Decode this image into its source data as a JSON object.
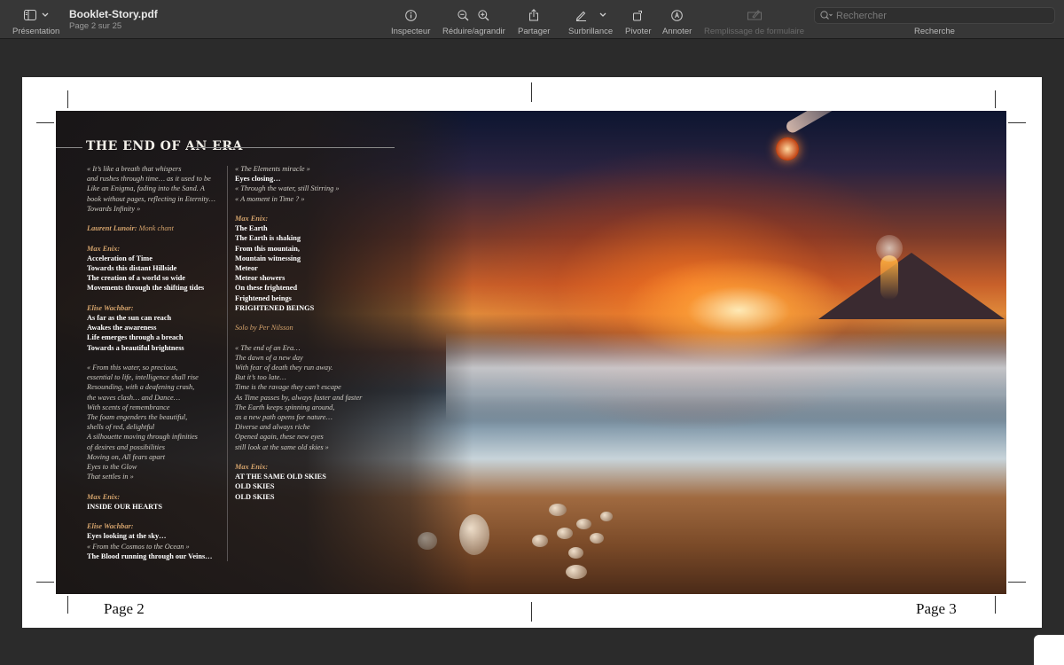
{
  "toolbar": {
    "presentation_label": "Présentation",
    "doc_name": "Booklet-Story.pdf",
    "doc_page": "Page 2 sur 25",
    "inspector_label": "Inspecteur",
    "zoom_label": "Réduire/agrandir",
    "share_label": "Partager",
    "highlight_label": "Surbrillance",
    "rotate_label": "Pivoter",
    "annotate_label": "Annoter",
    "form_label": "Remplissage de formulaire",
    "search_placeholder": "Rechercher",
    "search_label": "Recherche"
  },
  "spread": {
    "title": "THE END OF AN ERA",
    "left_column": [
      {
        "lines": [
          {
            "t": "« It’s like a breath that whispers",
            "s": "it"
          },
          {
            "t": "and rushes through time… as it used to be",
            "s": "it"
          },
          {
            "t": "Like an Enigma, fading into the Sand. A",
            "s": "it"
          },
          {
            "t": "book without pages, reflecting in Eternity…",
            "s": "it"
          },
          {
            "t": "Towards Infinity »",
            "s": "it"
          }
        ]
      },
      {
        "lines": [
          {
            "t": "Laurent Lunoir: ",
            "s": "spk",
            "t2": "Monk chant",
            "s2": "spk-inline"
          }
        ]
      },
      {
        "lines": [
          {
            "t": "Max Enix:",
            "s": "spk"
          },
          {
            "t": "Acceleration of Time",
            "s": "b"
          },
          {
            "t": "Towards this distant Hillside",
            "s": "b"
          },
          {
            "t": "The creation of a world so wide",
            "s": "b"
          },
          {
            "t": "Movements through the shifting tides",
            "s": "b"
          }
        ]
      },
      {
        "lines": [
          {
            "t": "Elise Wachbar:",
            "s": "spk"
          },
          {
            "t": "As far as the sun can reach",
            "s": "b"
          },
          {
            "t": "Awakes the awareness",
            "s": "b"
          },
          {
            "t": "Life emerges through a breach",
            "s": "b"
          },
          {
            "t": "Towards a beautiful brightness",
            "s": "b"
          }
        ]
      },
      {
        "lines": [
          {
            "t": "« From this water, so precious,",
            "s": "it"
          },
          {
            "t": "essential to life, intelligence shall rise",
            "s": "it"
          },
          {
            "t": "Resounding, with a deafening crash,",
            "s": "it"
          },
          {
            "t": "the waves clash… and Dance…",
            "s": "it"
          },
          {
            "t": "With scents of remembrance",
            "s": "it"
          },
          {
            "t": "The foam engenders the beautiful,",
            "s": "it"
          },
          {
            "t": "shells of red, delightful",
            "s": "it"
          },
          {
            "t": "A silhouette moving through infinities",
            "s": "it"
          },
          {
            "t": "of desires and possibilities",
            "s": "it"
          },
          {
            "t": "Moving on, All fears apart",
            "s": "it"
          },
          {
            "t": "Eyes to the Glow",
            "s": "it"
          },
          {
            "t": "That settles in »",
            "s": "it"
          }
        ]
      },
      {
        "lines": [
          {
            "t": "Max Enix:",
            "s": "spk"
          },
          {
            "t": "INSIDE OUR HEARTS",
            "s": "b"
          }
        ]
      },
      {
        "lines": [
          {
            "t": "Elise Wachbar:",
            "s": "spk"
          },
          {
            "t": "Eyes looking at the sky…",
            "s": "b"
          },
          {
            "t": "« From the Cosmos to the Ocean »",
            "s": "it"
          },
          {
            "t": "The Blood running through our Veins…",
            "s": "b"
          }
        ]
      }
    ],
    "right_column": [
      {
        "lines": [
          {
            "t": "« The Elements miracle »",
            "s": "it"
          },
          {
            "t": "Eyes closing…",
            "s": "b"
          },
          {
            "t": "« Through the water, still Stirring »",
            "s": "it"
          },
          {
            "t": "« A moment in Time ? »",
            "s": "it"
          }
        ]
      },
      {
        "lines": [
          {
            "t": "Max Enix:",
            "s": "spk"
          },
          {
            "t": "The Earth",
            "s": "b"
          },
          {
            "t": "The Earth is shaking",
            "s": "b"
          },
          {
            "t": "From this mountain,",
            "s": "b"
          },
          {
            "t": "Mountain witnessing",
            "s": "b"
          },
          {
            "t": "Meteor",
            "s": "b"
          },
          {
            "t": "Meteor showers",
            "s": "b"
          },
          {
            "t": "On these frightened",
            "s": "b"
          },
          {
            "t": "Frightened beings",
            "s": "b"
          },
          {
            "t": "FRIGHTENED BEINGS",
            "s": "b"
          }
        ]
      },
      {
        "lines": [
          {
            "t": "Solo by Per Nilsson",
            "s": "spk-inline"
          }
        ]
      },
      {
        "lines": [
          {
            "t": "« The end of an Era…",
            "s": "it"
          },
          {
            "t": "The dawn of a new day",
            "s": "it"
          },
          {
            "t": "With fear of death they run away.",
            "s": "it"
          },
          {
            "t": "But it’s too late…",
            "s": "it"
          },
          {
            "t": "Time is the ravage they can’t escape",
            "s": "it"
          },
          {
            "t": "As Time passes by, always faster and faster",
            "s": "it"
          },
          {
            "t": "The Earth keeps spinning around,",
            "s": "it"
          },
          {
            "t": "as a new path opens for nature…",
            "s": "it"
          },
          {
            "t": "Diverse and always riche",
            "s": "it"
          },
          {
            "t": "Opened again, these new eyes",
            "s": "it"
          },
          {
            "t": "still look at the same old skies »",
            "s": "it"
          }
        ]
      },
      {
        "lines": [
          {
            "t": "Max Enix:",
            "s": "spk"
          },
          {
            "t": "AT THE SAME OLD SKIES",
            "s": "b"
          },
          {
            "t": "OLD SKIES",
            "s": "b"
          },
          {
            "t": "OLD SKIES",
            "s": "b"
          }
        ]
      }
    ]
  },
  "pages": {
    "left": "Page 2",
    "right": "Page 3"
  },
  "colors": {
    "toolbar_bg": "#373737",
    "window_bg": "#2b2b2b",
    "speaker": "#d4a36c"
  },
  "icons": [
    "sidebar-icon",
    "chevron-down-icon",
    "info-icon",
    "zoom-out-icon",
    "zoom-in-icon",
    "share-icon",
    "pen-icon",
    "rotate-icon",
    "annotate-icon",
    "form-icon",
    "search-icon"
  ]
}
